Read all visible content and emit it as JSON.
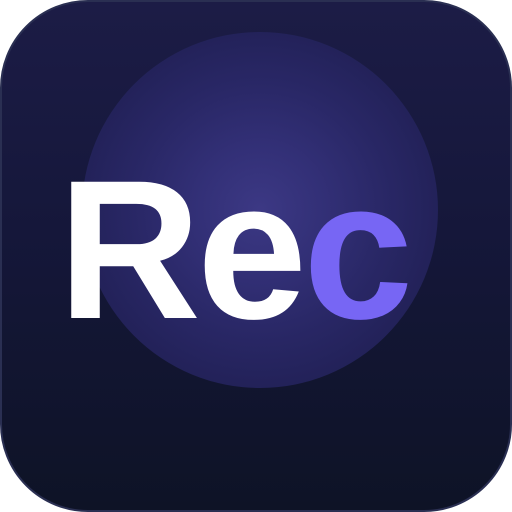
{
  "icon": {
    "text_main": "Re",
    "text_accent": "c",
    "colors": {
      "background_top": "#1c1c46",
      "background_bottom": "#0e1326",
      "glow": "#3e3a88",
      "text_main": "#ffffff",
      "text_accent": "#7766f4"
    }
  }
}
